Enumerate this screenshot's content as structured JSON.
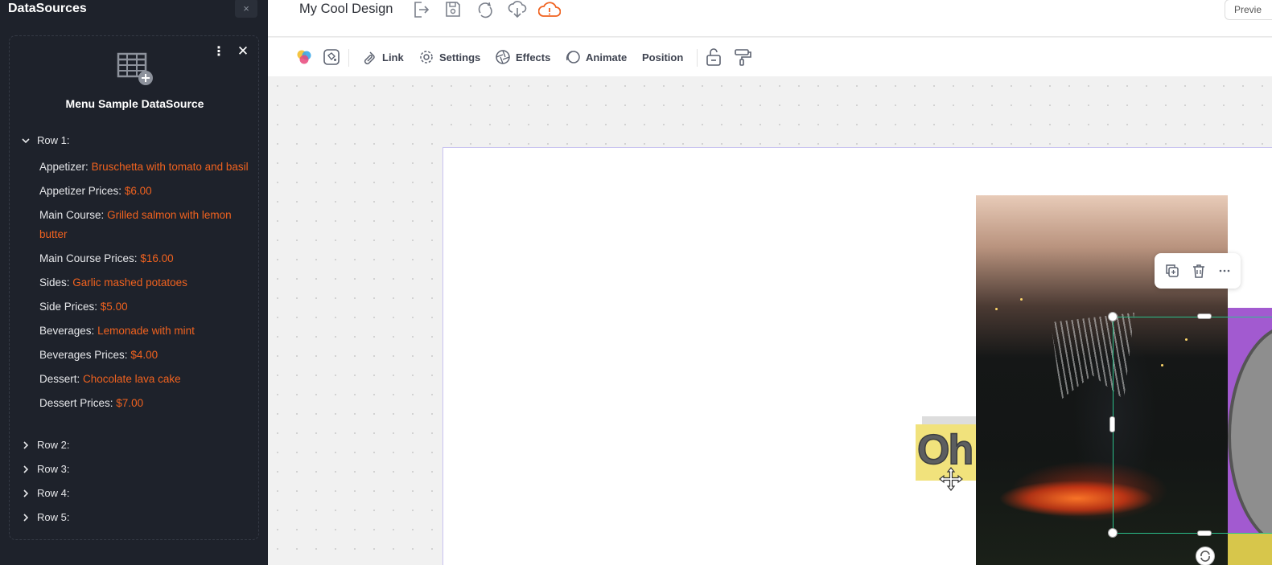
{
  "sidebar": {
    "title": "DataSources",
    "close_top_label": "×",
    "datasource": {
      "name": "Menu Sample DataSource",
      "rows": [
        {
          "label": "Row 1:",
          "expanded": true,
          "fields": [
            {
              "key": "Appetizer:",
              "value": "Bruschetta with tomato and basil"
            },
            {
              "key": "Appetizer Prices:",
              "value": "$6.00"
            },
            {
              "key": "Main Course:",
              "value": "Grilled salmon with lemon butter"
            },
            {
              "key": "Main Course Prices:",
              "value": "$16.00"
            },
            {
              "key": "Sides:",
              "value": "Garlic mashed potatoes"
            },
            {
              "key": "Side Prices:",
              "value": "$5.00"
            },
            {
              "key": "Beverages:",
              "value": "Lemonade with mint"
            },
            {
              "key": "Beverages Prices:",
              "value": "$4.00"
            },
            {
              "key": "Dessert:",
              "value": "Chocolate lava cake"
            },
            {
              "key": "Dessert Prices:",
              "value": "$7.00"
            }
          ]
        },
        {
          "label": "Row 2:",
          "expanded": false
        },
        {
          "label": "Row 3:",
          "expanded": false
        },
        {
          "label": "Row 4:",
          "expanded": false
        },
        {
          "label": "Row 5:",
          "expanded": false
        }
      ]
    }
  },
  "header": {
    "design_name": "My Cool Design",
    "preview_label": "Previe",
    "icons": [
      "export-icon",
      "save-icon",
      "sync-icon",
      "download-icon",
      "cloud-warning-icon"
    ]
  },
  "toolbar": {
    "link_label": "Link",
    "settings_label": "Settings",
    "effects_label": "Effects",
    "animate_label": "Animate",
    "position_label": "Position"
  },
  "canvas": {
    "text_element": "Oh"
  },
  "colors": {
    "sidebar_bg": "#1e222b",
    "value_accent": "#f0621f",
    "selection": "#2bbf8a",
    "artboard_border": "#c9c3f0",
    "warning": "#f0621f"
  }
}
